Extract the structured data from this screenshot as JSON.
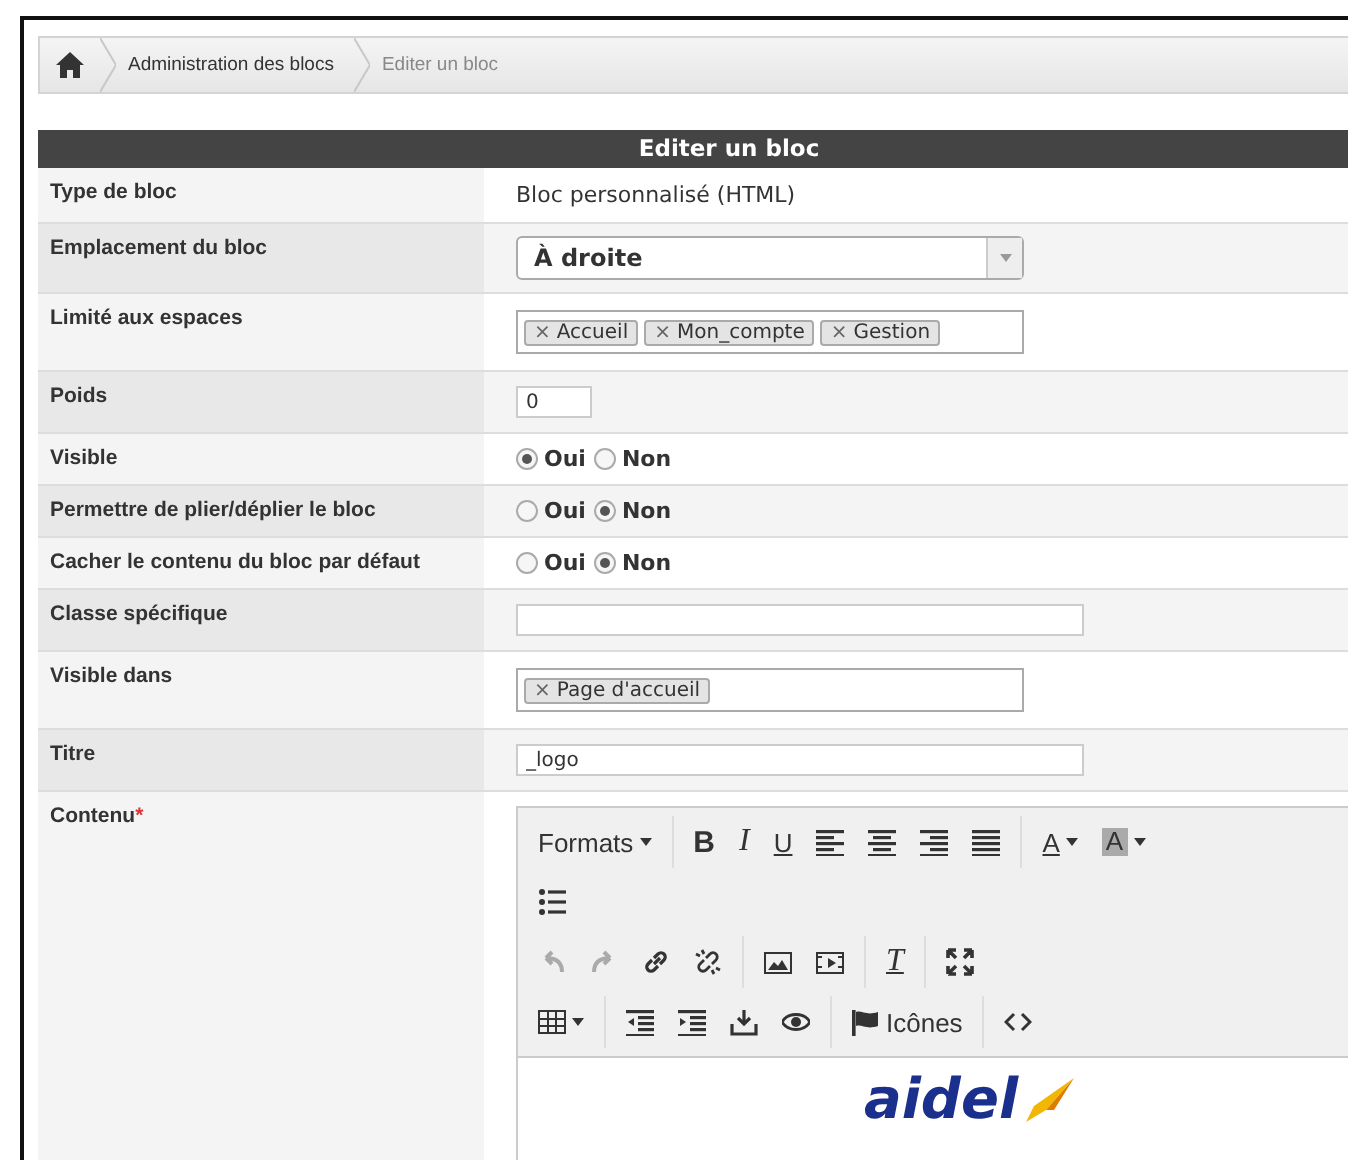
{
  "breadcrumb": [
    {
      "label": "Administration des blocs",
      "current": false
    },
    {
      "label": "Editer un bloc",
      "current": true
    }
  ],
  "form": {
    "title": "Editer un bloc",
    "rows": [
      {
        "label": "Type de bloc",
        "kind": "text",
        "value": "Bloc personnalisé (HTML)"
      },
      {
        "label": "Emplacement du bloc",
        "kind": "select",
        "value": "À droite"
      },
      {
        "label": "Limité aux espaces",
        "kind": "tags",
        "tags": [
          {
            "remove": "×",
            "label": "Accueil"
          },
          {
            "remove": "×",
            "label": "Mon_compte"
          },
          {
            "remove": "×",
            "label": "Gestion"
          }
        ]
      },
      {
        "label": "Poids",
        "kind": "short_input",
        "value": "0"
      },
      {
        "label": "Visible",
        "kind": "radio",
        "options": [
          {
            "label": "Oui",
            "selected": true
          },
          {
            "label": "Non",
            "selected": false
          }
        ]
      },
      {
        "label": "Permettre de plier/déplier le bloc",
        "kind": "radio",
        "options": [
          {
            "label": "Oui",
            "selected": false
          },
          {
            "label": "Non",
            "selected": true
          }
        ]
      },
      {
        "label": "Cacher le contenu du bloc par défaut",
        "kind": "radio",
        "options": [
          {
            "label": "Oui",
            "selected": false
          },
          {
            "label": "Non",
            "selected": true
          }
        ]
      },
      {
        "label": "Classe spécifique",
        "kind": "input",
        "value": ""
      },
      {
        "label": "Visible dans",
        "kind": "tags",
        "tags": [
          {
            "remove": "×",
            "label": "Page d'accueil"
          }
        ]
      },
      {
        "label": "Titre",
        "kind": "input",
        "value": "_logo"
      },
      {
        "label": "Contenu",
        "kind": "editor",
        "required_mark": "*"
      }
    ]
  },
  "editor": {
    "toolbar": [
      [
        [
          {
            "kind": "formats",
            "label": "Formats",
            "disabled": false
          }
        ],
        [
          {
            "kind": "bold",
            "label": "B",
            "disabled": false
          },
          {
            "kind": "italic",
            "label": "I",
            "disabled": false
          },
          {
            "kind": "underline",
            "label": "U",
            "disabled": false
          },
          {
            "kind": "alignleft",
            "disabled": false
          },
          {
            "kind": "aligncenter",
            "disabled": false
          },
          {
            "kind": "alignright",
            "disabled": false
          },
          {
            "kind": "justify",
            "disabled": false
          }
        ],
        [
          {
            "kind": "textcolor",
            "label": "A",
            "disabled": false
          },
          {
            "kind": "bgcolor",
            "label": "A",
            "disabled": false
          }
        ]
      ],
      [
        [
          {
            "kind": "bullist",
            "disabled": false
          }
        ]
      ],
      [
        [
          {
            "kind": "undo",
            "disabled": true
          },
          {
            "kind": "redo",
            "disabled": true
          },
          {
            "kind": "link",
            "disabled": false
          },
          {
            "kind": "unlink",
            "disabled": false
          }
        ],
        [
          {
            "kind": "image",
            "disabled": false
          },
          {
            "kind": "media",
            "disabled": false
          }
        ],
        [
          {
            "kind": "clearformat",
            "label": "T",
            "disabled": false
          }
        ],
        [
          {
            "kind": "fullscreen",
            "disabled": false
          }
        ]
      ],
      [
        [
          {
            "kind": "table",
            "disabled": false
          }
        ],
        [
          {
            "kind": "outdent",
            "disabled": false
          },
          {
            "kind": "indent",
            "disabled": false
          },
          {
            "kind": "insert",
            "disabled": false
          },
          {
            "kind": "preview",
            "disabled": false
          }
        ],
        [
          {
            "kind": "icons",
            "label": "Icônes",
            "disabled": false
          }
        ],
        [
          {
            "kind": "code",
            "disabled": false
          }
        ]
      ]
    ],
    "logo": "aidel"
  }
}
